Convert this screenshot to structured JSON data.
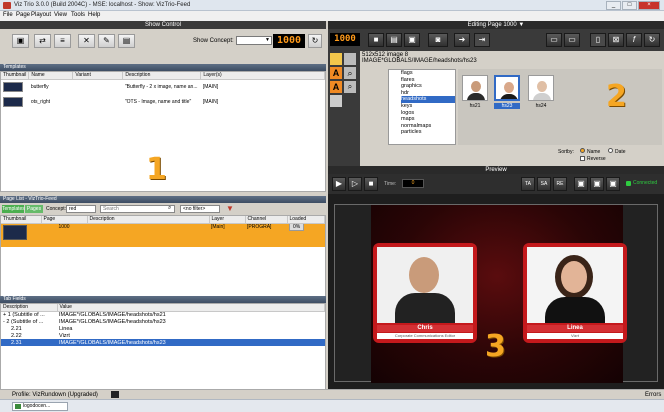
{
  "window": {
    "title": "Viz Trio 3.0.0 (Build 2004C) - MSE: localhost - Show: VizTrio-Feed",
    "min": "_",
    "max": "□",
    "close": "×"
  },
  "menu": [
    "File",
    "Page",
    "Playout",
    "View",
    "Tools",
    "Help"
  ],
  "show_control": {
    "title": "Show Control",
    "concept_label": "Show Concept:",
    "page_number": "1000",
    "templates": {
      "title": "Templates",
      "columns": [
        "Thumbnail",
        "Name",
        "Variant",
        "Description",
        "Layer(s)"
      ],
      "rows": [
        {
          "name": "butterfly",
          "variant": "",
          "description": "\"Butterfly - 2 x image, name an...",
          "layer": "[MAIN]"
        },
        {
          "name": "ots_right",
          "variant": "",
          "description": "\"OTS - Image, name and title\"",
          "layer": "[MAIN]"
        }
      ]
    }
  },
  "page_list": {
    "title": "Page List - VizTrio-Feed",
    "tab_active": "Templates",
    "tab_other": "Pages",
    "concept_label": "Concept:",
    "concept_value": "red",
    "search_placeholder": "Search",
    "filter_value": "<no filter>",
    "columns": [
      "Thumbnail",
      "Page",
      "Description",
      "Layer",
      "Channel",
      "Loaded"
    ],
    "rows": [
      {
        "page": "1000",
        "description": "",
        "layer": "[Main]",
        "channel": "[PROGRA]",
        "loaded": "0%"
      }
    ]
  },
  "tab_fields": {
    "title": "Tab Fields",
    "columns": [
      "Description",
      "Value"
    ],
    "rows": [
      {
        "desc": "1 (Subtitle of ...",
        "value": "IMAGE*/GLOBALS/IMAGE/headshots/hs21",
        "expand": "+",
        "indent": 0,
        "selected": false
      },
      {
        "desc": "2 (Subtitle of ...",
        "value": "IMAGE*/GLOBALS/IMAGE/headshots/hs23",
        "expand": "-",
        "indent": 0,
        "selected": false
      },
      {
        "desc": "2.21",
        "value": "Linea",
        "expand": "",
        "indent": 1,
        "selected": false
      },
      {
        "desc": "2.22",
        "value": "Vizrt",
        "expand": "",
        "indent": 1,
        "selected": false
      },
      {
        "desc": "2.31",
        "value": "IMAGE*/GLOBALS/IMAGE/headshots/hs23",
        "expand": "",
        "indent": 1,
        "selected": true
      }
    ]
  },
  "editing": {
    "title": "Editing Page 1000",
    "page_number": "1000",
    "image_size": "512x512 image 8",
    "image_path": "IMAGE*GLOBALS/IMAGE/headshots/hs23",
    "tree": [
      "flags",
      "flares",
      "graphics",
      "hdr",
      "headshots",
      "keys",
      "logos",
      "maps",
      "normalmaps",
      "particles"
    ],
    "tree_selected_index": 4,
    "thumbs": [
      {
        "label": "hs21",
        "kind": "man"
      },
      {
        "label": "hs23",
        "kind": "woman"
      },
      {
        "label": "hs24",
        "kind": "woman2"
      }
    ],
    "sort_label": "Sortby:",
    "sort_name": "Name",
    "sort_date": "Date",
    "reverse_label": "Reverse"
  },
  "preview": {
    "title": "Preview",
    "time_label": "Time:",
    "time_value": "0",
    "buttons": [
      "TA",
      "SA",
      "RE"
    ],
    "connected_label": "Connected",
    "cards": [
      {
        "name": "Chris",
        "subtitle": "Corporate Communications Editor"
      },
      {
        "name": "Linea",
        "subtitle": "Vizrt"
      }
    ]
  },
  "markers": [
    "1",
    "2",
    "3"
  ],
  "statusbar": {
    "profile": "Profile: VizRundown (Upgraded)",
    "error_label": "Errors"
  },
  "taskbar": {
    "item": "logodocen..."
  },
  "colors": {
    "accent_orange": "#f5a623",
    "card_red": "#c4191c",
    "row_orange": "#f5a623",
    "selected_blue": "#316ac5"
  }
}
